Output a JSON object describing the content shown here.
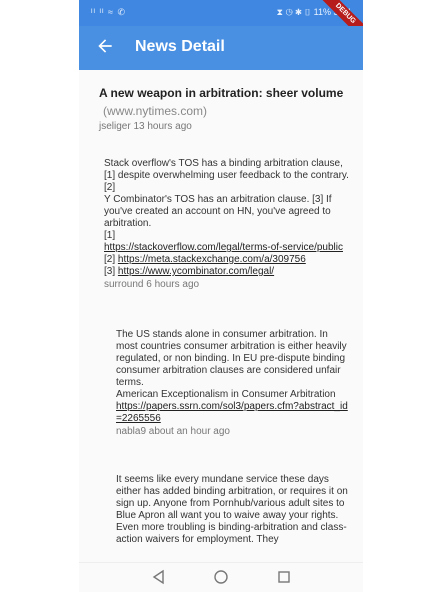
{
  "status": {
    "left": "ᴵᴵ ᴵᴵ ≈ ✆",
    "right": "⧗ ◷ ✱ ▯ 11% 3:24"
  },
  "debug": "DEBUG",
  "appbar": {
    "title": "News Detail"
  },
  "story": {
    "title": "A new weapon in arbitration: sheer volume",
    "domain": "(www.nytimes.com)",
    "meta": "jseliger 13 hours ago"
  },
  "comments": [
    {
      "lines": [
        "Stack overflow's TOS has a binding arbitration clause, [1] despite overwhelming user feedback to the contrary. [2]",
        "Y Combinator's TOS has an arbitration clause. [3] If you've created an account on HN, you've agreed to arbitration.",
        "[1]"
      ],
      "link1": "https://stackoverflow.com/legal/terms-of-service/public",
      "ref2": "[2] ",
      "link2": "https://meta.stackexchange.com/a/309756",
      "ref3": "[3] ",
      "link3": "https://www.ycombinator.com/legal/",
      "meta": "surround 6 hours ago"
    },
    {
      "lines": [
        "The US stands alone in consumer arbitration. In most countries consumer arbitration is either heavily regulated, or non binding.  In EU  pre-dispute binding consumer arbitration clauses are  considered unfair terms.",
        "American Exceptionalism in Consumer Arbitration"
      ],
      "link1": "https://papers.ssrn.com/sol3/papers.cfm?abstract_id=2265556",
      "meta": "nabla9 about an hour ago"
    },
    {
      "lines": [
        "It seems like every mundane service these days either has added binding arbitration, or requires it on sign up. Anyone from Pornhub/various adult sites to Blue Apron all want you to waive away your rights.",
        "Even more troubling is binding-arbitration and class-action waivers for employment. They"
      ]
    }
  ],
  "navbar": {
    "back_icon": "triangle-back-icon",
    "home_icon": "circle-home-icon",
    "recent_icon": "square-recents-icon"
  }
}
